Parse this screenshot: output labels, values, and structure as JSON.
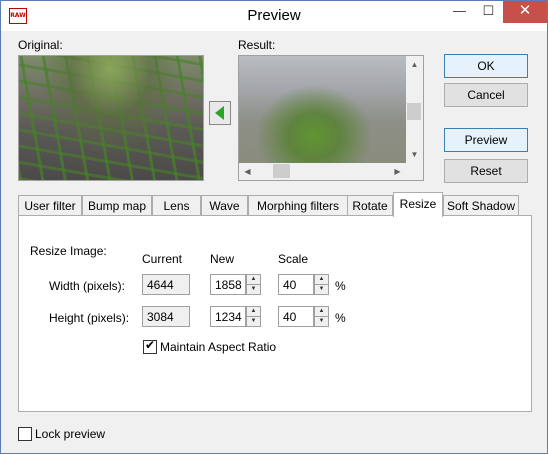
{
  "window": {
    "title": "Preview",
    "app_icon_text": "RAW"
  },
  "titlebar": {
    "minimize": "—",
    "maximize": "☐",
    "close": "✕"
  },
  "labels": {
    "original": "Original:",
    "result": "Result:"
  },
  "buttons": {
    "ok": "OK",
    "cancel": "Cancel",
    "preview": "Preview",
    "reset": "Reset"
  },
  "tabs": [
    {
      "label": "User filter"
    },
    {
      "label": "Bump map"
    },
    {
      "label": "Lens"
    },
    {
      "label": "Wave"
    },
    {
      "label": "Morphing filters"
    },
    {
      "label": "Rotate"
    },
    {
      "label": "Resize",
      "active": true
    },
    {
      "label": "Soft Shadow"
    }
  ],
  "resize": {
    "section_label": "Resize Image:",
    "col_current": "Current",
    "col_new": "New",
    "col_scale": "Scale",
    "width_label": "Width (pixels):",
    "height_label": "Height (pixels):",
    "width_current": "4644",
    "width_new": "1858",
    "width_scale": "40",
    "height_current": "3084",
    "height_new": "1234",
    "height_scale": "40",
    "percent": "%",
    "maintain_aspect_label": "Maintain Aspect Ratio",
    "maintain_aspect_checked": true
  },
  "lock_preview": {
    "label": "Lock preview",
    "checked": false
  },
  "colors": {
    "accent_green": "#2aa52a",
    "close_red": "#c7504b",
    "default_button_border": "#3c7fb1"
  },
  "icons": {
    "green_arrow": "arrow-left-icon",
    "scroll_up": "▲",
    "scroll_down": "▼",
    "scroll_left": "◀",
    "scroll_right": "▶",
    "spin_up": "▲",
    "spin_down": "▼",
    "check": "✔"
  }
}
